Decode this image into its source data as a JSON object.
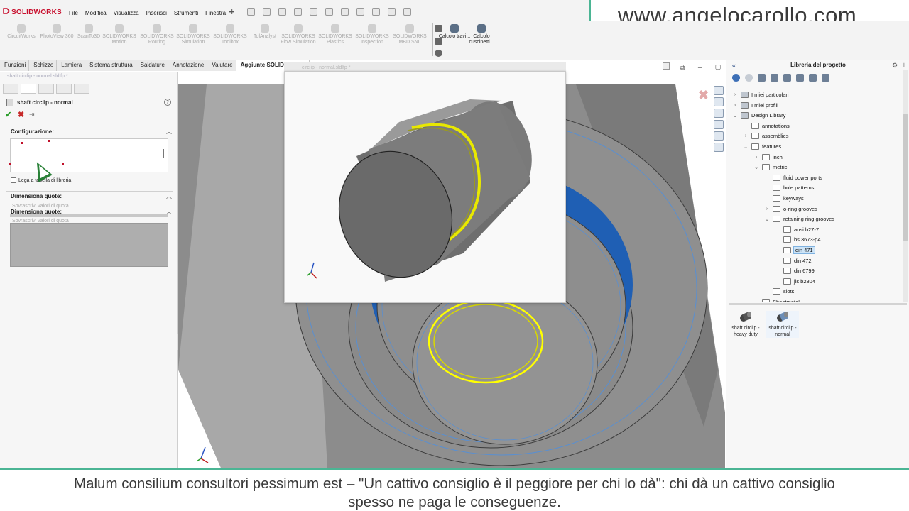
{
  "app": {
    "name": "SOLIDWORKS",
    "menu": [
      "File",
      "Modifica",
      "Visualizza",
      "Inserisci",
      "Strumenti",
      "Finestra"
    ]
  },
  "watermark": "www.angelocarollo.com",
  "ribbon": {
    "addins": [
      {
        "label": "CircuitWorks",
        "active": false
      },
      {
        "label": "PhotoView 360",
        "active": false
      },
      {
        "label": "ScanTo3D",
        "active": false
      },
      {
        "label": "SOLIDWORKS Motion",
        "active": false
      },
      {
        "label": "SOLIDWORKS Routing",
        "active": false
      },
      {
        "label": "SOLIDWORKS Simulation",
        "active": false
      },
      {
        "label": "SOLIDWORKS Toolbox",
        "active": false
      },
      {
        "label": "TolAnalyst",
        "active": false
      },
      {
        "label": "SOLIDWORKS Flow Simulation",
        "active": false
      },
      {
        "label": "SOLIDWORKS Plastics",
        "active": false
      },
      {
        "label": "SOLIDWORKS Inspection",
        "active": false
      },
      {
        "label": "SOLIDWORKS MBD SNL",
        "active": false
      },
      {
        "label": "Calcolo travi...",
        "active": true
      },
      {
        "label": "Calcolo cuscinetti...",
        "active": true
      }
    ]
  },
  "tabs": [
    "Funzioni",
    "Schizzo",
    "Lamiera",
    "Sistema struttura",
    "Saldature",
    "Annotazione",
    "Valutare",
    "Aggiunte SOLIDWORKS"
  ],
  "active_tab": "Aggiunte SOLIDWORKS",
  "property_manager": {
    "doc_title": "shaft circlip - normal.sldlfp *",
    "title": "shaft circlip - normal",
    "config_label": "Configurazione:",
    "link_label": "Lega a tabella di libreria",
    "dim_label": "Dimensiona quote:",
    "override_label": "Sovrascrivi valori di quota",
    "dim_label_ghost": "Dimensiona quote:",
    "override_ghost": "Sovrascrivi valori di quota"
  },
  "preview": {
    "tab_title": "circlip - normal.sldlfp *"
  },
  "library": {
    "title": "Libreria del progetto",
    "tree": [
      {
        "label": "I miei particolari",
        "depth": 0,
        "twisty": ">",
        "icon": "library"
      },
      {
        "label": "I miei profili",
        "depth": 0,
        "twisty": ">",
        "icon": "library"
      },
      {
        "label": "Design Library",
        "depth": 0,
        "twisty": "v",
        "icon": "library"
      },
      {
        "label": "annotations",
        "depth": 1,
        "twisty": "",
        "icon": "folder"
      },
      {
        "label": "assemblies",
        "depth": 1,
        "twisty": ">",
        "icon": "folder"
      },
      {
        "label": "features",
        "depth": 1,
        "twisty": "v",
        "icon": "folder"
      },
      {
        "label": "inch",
        "depth": 2,
        "twisty": ">",
        "icon": "folder"
      },
      {
        "label": "metric",
        "depth": 2,
        "twisty": "v",
        "icon": "folder"
      },
      {
        "label": "fluid power ports",
        "depth": 3,
        "twisty": "",
        "icon": "folder"
      },
      {
        "label": "hole patterns",
        "depth": 3,
        "twisty": "",
        "icon": "folder"
      },
      {
        "label": "keyways",
        "depth": 3,
        "twisty": "",
        "icon": "folder"
      },
      {
        "label": "o-ring grooves",
        "depth": 3,
        "twisty": ">",
        "icon": "folder"
      },
      {
        "label": "retaining ring grooves",
        "depth": 3,
        "twisty": "v",
        "icon": "folder"
      },
      {
        "label": "ansi b27-7",
        "depth": 4,
        "twisty": "",
        "icon": "folder"
      },
      {
        "label": "bs 3673-p4",
        "depth": 4,
        "twisty": "",
        "icon": "folder"
      },
      {
        "label": "din 471",
        "depth": 4,
        "twisty": "",
        "icon": "folder",
        "selected": true
      },
      {
        "label": "din 472",
        "depth": 4,
        "twisty": "",
        "icon": "folder"
      },
      {
        "label": "din 6799",
        "depth": 4,
        "twisty": "",
        "icon": "folder"
      },
      {
        "label": "jis b2804",
        "depth": 4,
        "twisty": "",
        "icon": "folder"
      },
      {
        "label": "slots",
        "depth": 3,
        "twisty": "",
        "icon": "folder"
      },
      {
        "label": "Sheetmetal",
        "depth": 2,
        "twisty": "",
        "icon": "folder"
      }
    ],
    "parts": [
      {
        "line1": "shaft circlip -",
        "line2": "heavy duty"
      },
      {
        "line1": "shaft circlip -",
        "line2": "normal"
      }
    ]
  },
  "subtitle": {
    "line1": "Malum consilium consultori pessimum est – \"Un cattivo consiglio è il peggiore per chi lo dà\": chi dà un cattivo consiglio",
    "line2": "spesso ne paga le conseguenze."
  },
  "colors": {
    "accent": "#4bb594",
    "selection": "#ffff00",
    "groove_blue": "#1f5fb4",
    "model_gray": "#9a9a9a"
  }
}
